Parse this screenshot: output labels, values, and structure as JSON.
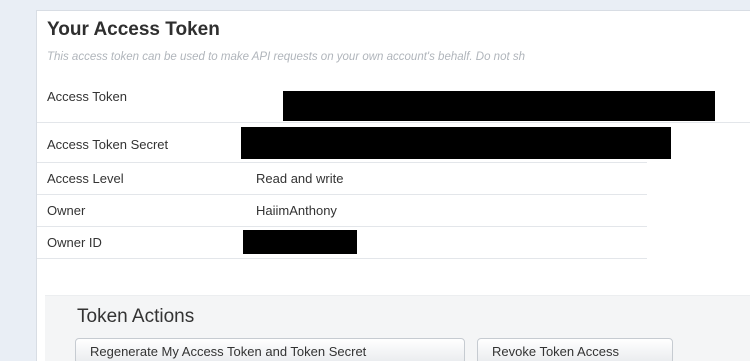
{
  "section": {
    "title": "Your Access Token",
    "subtitle": "This access token can be used to make API requests on your own account's behalf. Do not sh"
  },
  "fields": [
    {
      "label": "Access Token",
      "value": ""
    },
    {
      "label": "Access Token Secret",
      "value": ""
    },
    {
      "label": "Access Level",
      "value": "Read and write"
    },
    {
      "label": "Owner",
      "value": "HaiimAnthony"
    },
    {
      "label": "Owner ID",
      "value": ""
    }
  ],
  "token_actions": {
    "title": "Token Actions",
    "regenerate_label": "Regenerate My Access Token and Token Secret",
    "revoke_label": "Revoke Token Access"
  }
}
